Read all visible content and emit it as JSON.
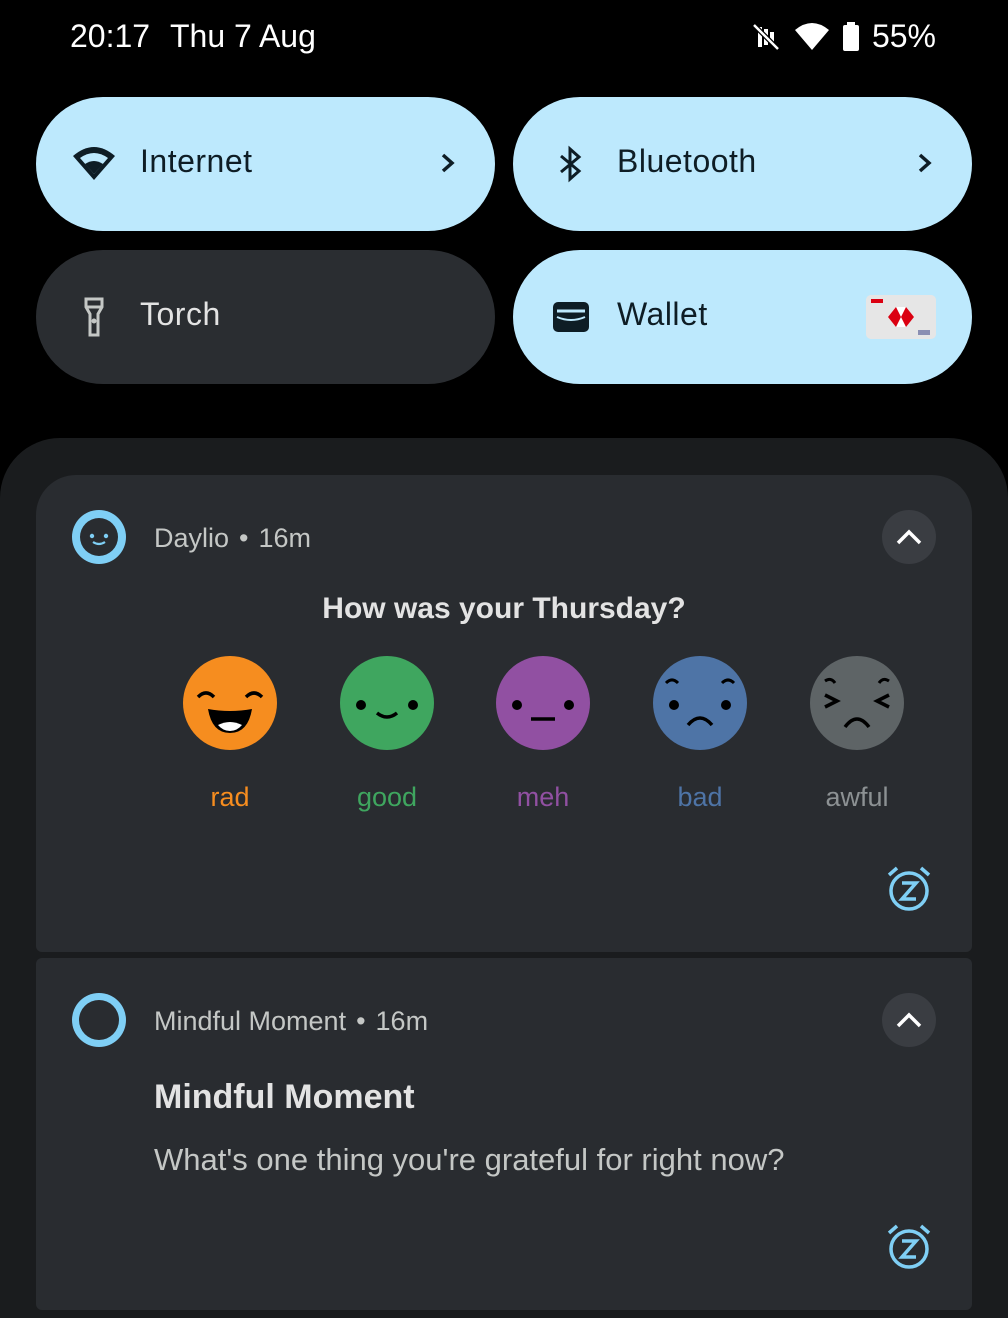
{
  "status_bar": {
    "time": "20:17",
    "date": "Thu 7 Aug",
    "battery": "55%",
    "icons": [
      "mute-icon",
      "wifi-icon",
      "battery-icon"
    ]
  },
  "quick_settings": {
    "tiles": [
      {
        "label": "Internet",
        "icon": "wifi-icon",
        "active": true,
        "chevron": true
      },
      {
        "label": "Bluetooth",
        "icon": "bluetooth-icon",
        "active": true,
        "chevron": true
      },
      {
        "label": "Torch",
        "icon": "torch-icon",
        "active": false
      },
      {
        "label": "Wallet",
        "icon": "wallet-icon",
        "active": true,
        "card": "card-thumbnail"
      }
    ]
  },
  "notifications": [
    {
      "app": "Daylio",
      "separator": "•",
      "time": "16m",
      "question": "How was your Thursday?",
      "moods": [
        {
          "label": "rad",
          "color": "#f68d1f"
        },
        {
          "label": "good",
          "color": "#3fa65f"
        },
        {
          "label": "meh",
          "color": "#9150a2"
        },
        {
          "label": "bad",
          "color": "#4e74a6"
        },
        {
          "label": "awful",
          "color": "#5e6466"
        }
      ]
    },
    {
      "app": "Mindful Moment",
      "separator": "•",
      "time": "16m",
      "title": "Mindful Moment",
      "body": "What's one thing you're grateful for right now?"
    }
  ],
  "colors": {
    "tile_active": "#bde9fd",
    "tile_inactive": "#2a2d31",
    "accent": "#7fcff5"
  }
}
